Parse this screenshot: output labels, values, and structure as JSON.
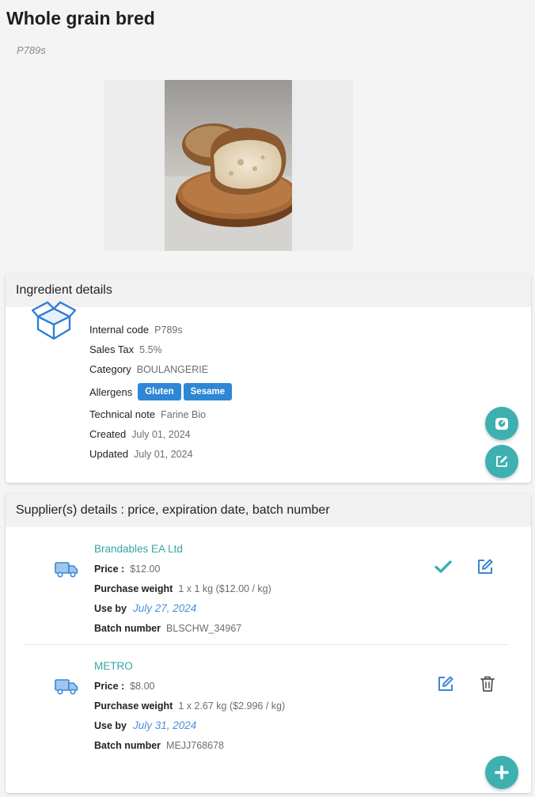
{
  "product": {
    "title": "Whole grain bred",
    "code": "P789s"
  },
  "ingredient_card": {
    "header": "Ingredient details",
    "fields": {
      "internal_code": {
        "label": "Internal code",
        "value": "P789s"
      },
      "sales_tax": {
        "label": "Sales Tax",
        "value": "5.5%"
      },
      "category": {
        "label": "Category",
        "value": "BOULANGERIE"
      },
      "allergens": {
        "label": "Allergens",
        "values": [
          "Gluten",
          "Sesame"
        ]
      },
      "technical_note": {
        "label": "Technical note",
        "value": "Farine Bio"
      },
      "created": {
        "label": "Created",
        "value": "July 01, 2024"
      },
      "updated": {
        "label": "Updated",
        "value": "July 01, 2024"
      }
    },
    "icons": {
      "product_icon": "open-box-icon",
      "fab_1": "scale-icon",
      "fab_2": "edit-icon"
    }
  },
  "suppliers_card": {
    "header": "Supplier(s) details : price, expiration date, batch number",
    "labels": {
      "price": "Price :",
      "purchase_weight": "Purchase weight",
      "use_by": "Use by",
      "batch_number": "Batch number"
    },
    "suppliers": [
      {
        "name": "Brandables EA Ltd",
        "price": "$12.00",
        "purchase_weight": "1 x 1 kg ($12.00 / kg)",
        "use_by": "July 27, 2024",
        "batch_number": "BLSCHW_34967",
        "actions": [
          "check-icon",
          "edit-icon"
        ]
      },
      {
        "name": "METRO",
        "price": "$8.00",
        "purchase_weight": "1 x 2.67 kg ($2.996 / kg)",
        "use_by": "July 31, 2024",
        "batch_number": "MEJJ768678",
        "actions": [
          "edit-icon",
          "trash-icon"
        ]
      }
    ]
  },
  "colors": {
    "accent_teal": "#3fb0b0",
    "badge_blue": "#2e86d6",
    "icon_blue": "#4a90d9",
    "supplier_name": "#3aa3a3"
  }
}
